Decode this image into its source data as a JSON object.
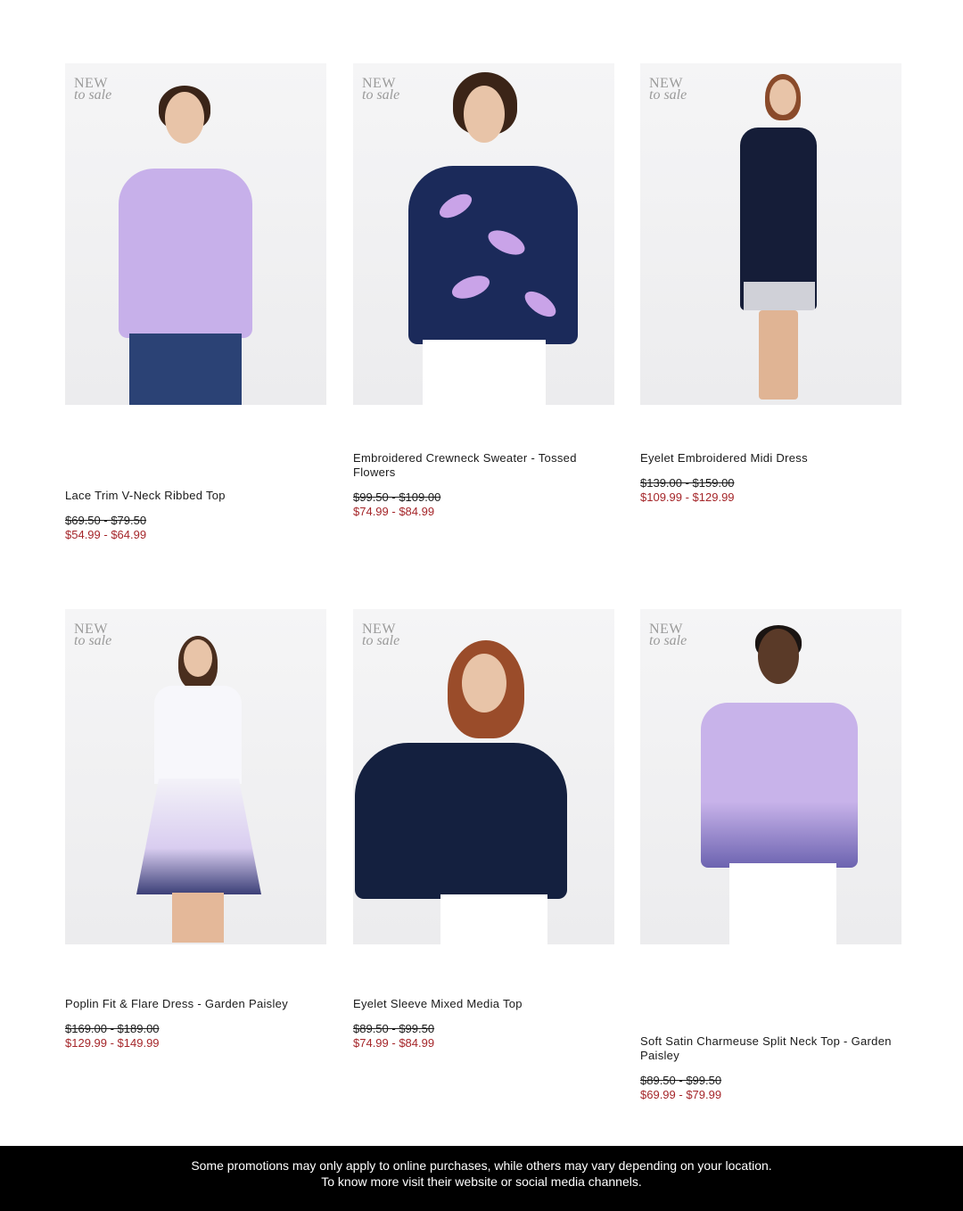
{
  "badge": {
    "line1": "NEW",
    "line2": "to sale"
  },
  "products": [
    {
      "name": "Lace Trim V-Neck Ribbed Top",
      "original_price": "$69.50 - $79.50",
      "sale_price": "$54.99 - $64.99",
      "image_alt": "lavender-top-photo"
    },
    {
      "name": "Embroidered Crewneck Sweater - Tossed Flowers",
      "original_price": "$99.50 - $109.00",
      "sale_price": "$74.99 - $84.99",
      "image_alt": "navy-leaf-sweater-photo"
    },
    {
      "name": "Eyelet Embroidered Midi Dress",
      "original_price": "$139.00 - $159.00",
      "sale_price": "$109.99 - $129.99",
      "image_alt": "navy-midi-dress-photo"
    },
    {
      "name": "Poplin Fit & Flare Dress - Garden Paisley",
      "original_price": "$169.00 - $189.00",
      "sale_price": "$129.99 - $149.99",
      "image_alt": "paisley-dress-photo"
    },
    {
      "name": "Eyelet Sleeve Mixed Media Top",
      "original_price": "$89.50 - $99.50",
      "sale_price": "$74.99 - $84.99",
      "image_alt": "navy-eyelet-top-photo"
    },
    {
      "name": "Soft Satin Charmeuse Split Neck Top - Garden Paisley",
      "original_price": "$89.50 - $99.50",
      "sale_price": "$69.99 - $79.99",
      "image_alt": "lavender-paisley-top-photo"
    }
  ],
  "footer": {
    "line1": "Some promotions may only apply to online purchases, while others may vary depending on your location.",
    "line2": "To know more visit their website or social media channels."
  },
  "colors": {
    "sale_price": "#a5262a",
    "footer_bg": "#000000",
    "badge": "#9a9a9a"
  }
}
